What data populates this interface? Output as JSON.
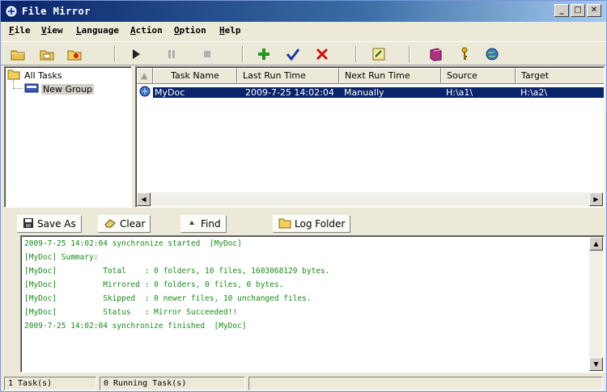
{
  "window": {
    "title": "File Mirror"
  },
  "menu": {
    "items": [
      {
        "first": "F",
        "rest": "ile"
      },
      {
        "first": "V",
        "rest": "iew"
      },
      {
        "first": "L",
        "rest": "anguage"
      },
      {
        "first": "A",
        "rest": "ction"
      },
      {
        "first": "O",
        "rest": "ption"
      },
      {
        "first": "H",
        "rest": "elp"
      }
    ]
  },
  "toolbar": {
    "icons": [
      "new-task-icon",
      "open-folder-icon",
      "group-icon",
      "run-icon",
      "pause-icon",
      "stop-icon",
      "add-icon",
      "check-icon",
      "delete-icon",
      "edit-icon",
      "book-icon",
      "key-icon",
      "web-icon"
    ],
    "colors": {
      "add": "#1a9a1a",
      "check": "#1a3aa0",
      "delete": "#d01010"
    }
  },
  "tree": {
    "items": [
      {
        "label": "All Tasks"
      },
      {
        "label": "New Group"
      }
    ]
  },
  "tasklist": {
    "columns": [
      "Task Name",
      "Last Run Time",
      "Next Run Time",
      "Source",
      "Target"
    ],
    "rows": [
      {
        "name": "MyDoc",
        "last_run": "2009-7-25 14:02:04",
        "next_run": "Manually",
        "source": "H:\\a1\\",
        "target": "H:\\a2\\"
      }
    ]
  },
  "logbar": {
    "save_as": "Save As",
    "clear": "Clear",
    "find": "Find",
    "log_folder": "Log Folder"
  },
  "log": {
    "color": "#1a8a1a",
    "lines": [
      "2009-7-25 14:02:04 synchronize started  [MyDoc]",
      "[MyDoc] Summary:",
      "[MyDoc]          Total    : 0 folders, 10 files, 1603068129 bytes.",
      "[MyDoc]          Mirrored : 0 folders, 0 files, 0 bytes.",
      "[MyDoc]          Skipped  : 0 newer files, 10 unchanged files.",
      "[MyDoc]          Status   : Mirror Succeeded!!",
      "2009-7-25 14:02:04 synchronize finished  [MyDoc]"
    ]
  },
  "status": {
    "tasks": "1 Task(s)",
    "running": "0 Running Task(s)"
  }
}
